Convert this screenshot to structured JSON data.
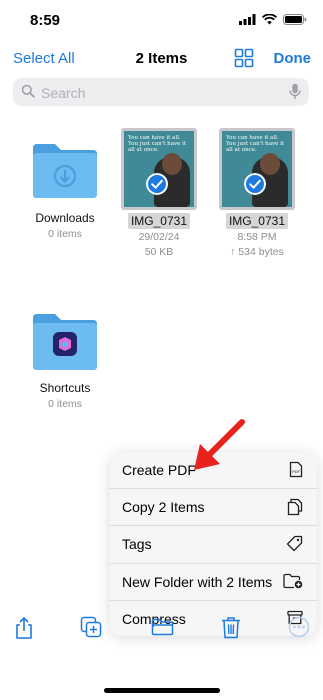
{
  "status": {
    "time": "8:59"
  },
  "nav": {
    "select_all": "Select All",
    "title": "2 Items",
    "done": "Done"
  },
  "search": {
    "placeholder": "Search"
  },
  "items": [
    {
      "name": "Downloads",
      "meta1": "0 items"
    },
    {
      "name": "IMG_0731",
      "meta1": "29/02/24",
      "meta2": "50 KB",
      "quote": "You can have it all. You just can't have it all at once."
    },
    {
      "name": "IMG_0731",
      "meta1": "8:58 PM",
      "meta2": "↑ 534 bytes",
      "quote": "You can have it all. You just can't have it all at once."
    },
    {
      "name": "Shortcuts",
      "meta1": "0 items"
    }
  ],
  "menu": {
    "items": [
      {
        "label": "Create PDF",
        "icon": "pdf-document-icon"
      },
      {
        "label": "Copy 2 Items",
        "icon": "copy-documents-icon"
      },
      {
        "label": "Tags",
        "icon": "tag-icon"
      },
      {
        "label": "New Folder with 2 Items",
        "icon": "folder-badge-plus-icon"
      },
      {
        "label": "Compress",
        "icon": "archive-box-icon"
      }
    ]
  },
  "colors": {
    "accent": "#1f7ae0",
    "folder": "#5aaeea",
    "annotation_arrow": "#e8231d"
  }
}
